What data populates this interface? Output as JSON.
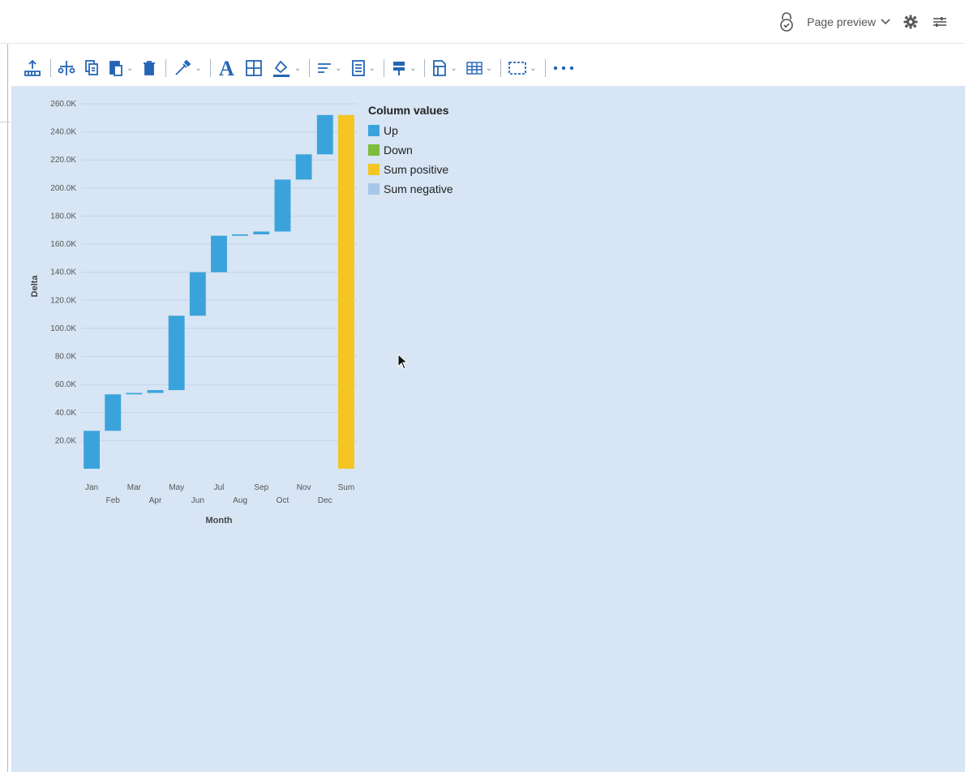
{
  "header": {
    "preview_label": "Page preview",
    "icons": [
      "lock-check-icon",
      "gear-icon",
      "sliders-icon"
    ]
  },
  "toolbar": {
    "items": [
      "export-icon",
      "cut-icon",
      "copy-icon",
      "paste-icon",
      "delete-icon",
      "color-picker-icon",
      "font-icon",
      "table-border-icon",
      "fill-color-icon",
      "align-icon",
      "vertical-align-icon",
      "pin-icon",
      "page-icon",
      "grid-icon",
      "frame-icon",
      "more-icon"
    ]
  },
  "chart_data": {
    "type": "waterfall",
    "xlabel": "Month",
    "ylabel": "Delta",
    "ylim": [
      0,
      260000
    ],
    "y_ticks": [
      "20.0K",
      "40.0K",
      "60.0K",
      "80.0K",
      "100.0K",
      "120.0K",
      "140.0K",
      "160.0K",
      "180.0K",
      "200.0K",
      "220.0K",
      "240.0K",
      "260.0K"
    ],
    "categories": [
      "Jan",
      "Feb",
      "Mar",
      "Apr",
      "May",
      "Jun",
      "Jul",
      "Aug",
      "Sep",
      "Oct",
      "Nov",
      "Dec",
      "Sum"
    ],
    "bars": [
      {
        "category": "Jan",
        "kind": "Up",
        "start": 0,
        "end": 27000
      },
      {
        "category": "Feb",
        "kind": "Up",
        "start": 27000,
        "end": 53000
      },
      {
        "category": "Mar",
        "kind": "Up",
        "start": 53000,
        "end": 54000
      },
      {
        "category": "Apr",
        "kind": "Up",
        "start": 54000,
        "end": 56000
      },
      {
        "category": "May",
        "kind": "Up",
        "start": 56000,
        "end": 109000
      },
      {
        "category": "Jun",
        "kind": "Up",
        "start": 109000,
        "end": 140000
      },
      {
        "category": "Jul",
        "kind": "Up",
        "start": 140000,
        "end": 166000
      },
      {
        "category": "Aug",
        "kind": "Up",
        "start": 166000,
        "end": 167000
      },
      {
        "category": "Sep",
        "kind": "Up",
        "start": 167000,
        "end": 169000
      },
      {
        "category": "Oct",
        "kind": "Up",
        "start": 169000,
        "end": 206000
      },
      {
        "category": "Nov",
        "kind": "Up",
        "start": 206000,
        "end": 224000
      },
      {
        "category": "Dec",
        "kind": "Up",
        "start": 224000,
        "end": 252000
      },
      {
        "category": "Sum",
        "kind": "Sum positive",
        "start": 0,
        "end": 252000
      }
    ],
    "legend": {
      "title": "Column values",
      "position": "top-right",
      "items": [
        {
          "label": "Up",
          "color": "#3ba3db"
        },
        {
          "label": "Down",
          "color": "#7cbd3b"
        },
        {
          "label": "Sum positive",
          "color": "#f5c521"
        },
        {
          "label": "Sum negative",
          "color": "#a8c6e8"
        }
      ]
    },
    "grid": true
  }
}
